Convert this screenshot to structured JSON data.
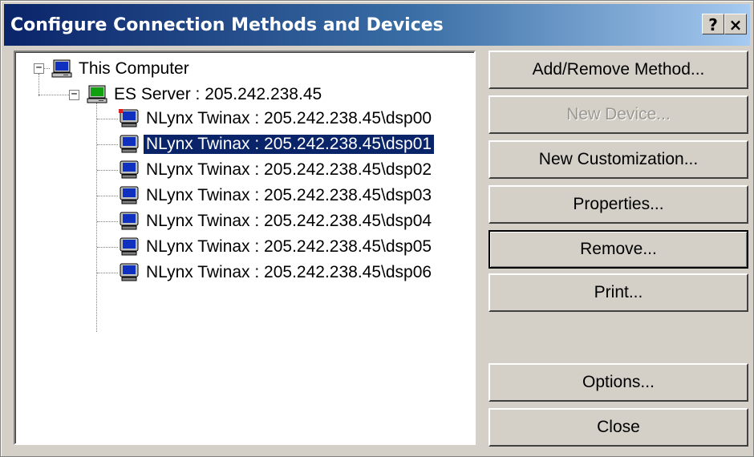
{
  "window": {
    "title": "Configure Connection Methods and Devices",
    "help_label": "?",
    "close_label": "×"
  },
  "tree": {
    "root": {
      "label": "This Computer",
      "icon": "computer-icon"
    },
    "server": {
      "label": "ES Server : 205.242.238.45",
      "icon": "server-icon"
    },
    "devices": [
      {
        "label": "NLynx Twinax : 205.242.238.45\\dsp00",
        "selected": false
      },
      {
        "label": "NLynx Twinax : 205.242.238.45\\dsp01",
        "selected": true
      },
      {
        "label": "NLynx Twinax : 205.242.238.45\\dsp02",
        "selected": false
      },
      {
        "label": "NLynx Twinax : 205.242.238.45\\dsp03",
        "selected": false
      },
      {
        "label": "NLynx Twinax : 205.242.238.45\\dsp04",
        "selected": false
      },
      {
        "label": "NLynx Twinax : 205.242.238.45\\dsp05",
        "selected": false
      },
      {
        "label": "NLynx Twinax : 205.242.238.45\\dsp06",
        "selected": false
      }
    ]
  },
  "buttons": {
    "add_remove_method": "Add/Remove Method...",
    "new_device": "New Device...",
    "new_customization": "New Customization...",
    "properties": "Properties...",
    "remove": "Remove...",
    "print": "Print...",
    "options": "Options...",
    "close": "Close"
  },
  "colors": {
    "title_start": "#0a246a",
    "title_end": "#a6caf0",
    "selection": "#0a246a",
    "face": "#d4d0c8"
  }
}
